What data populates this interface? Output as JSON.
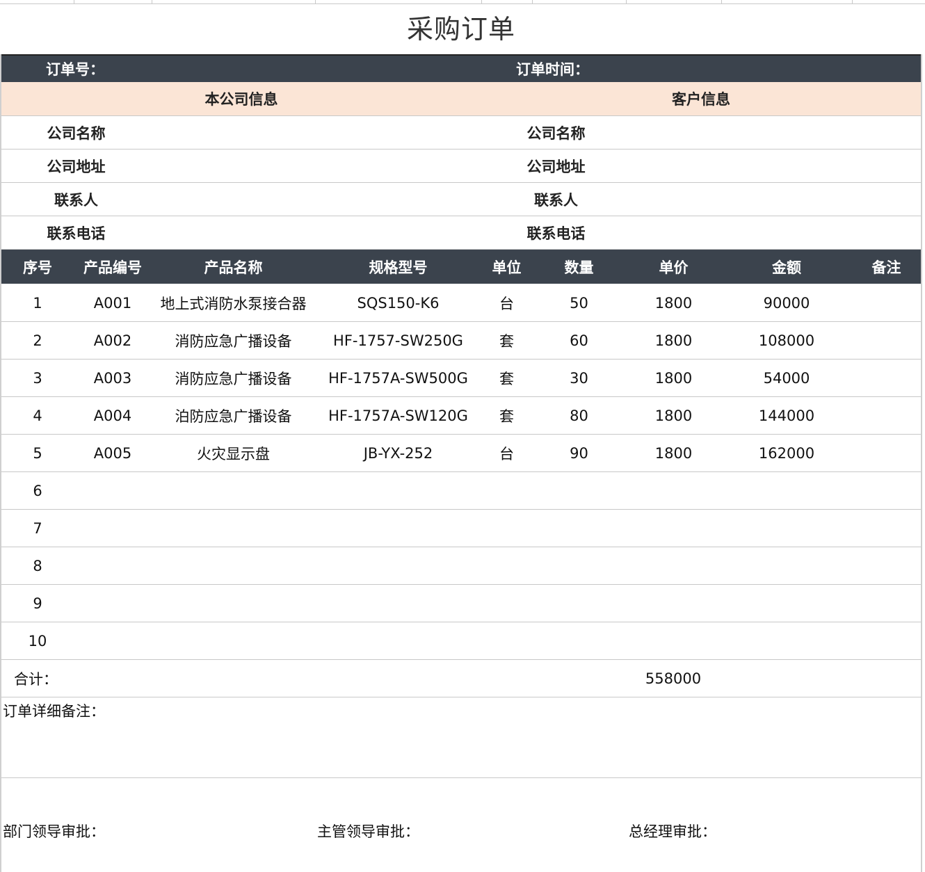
{
  "title": "采购订单",
  "order_bar": {
    "order_no_label": "订单号：",
    "order_time_label": "订单时间："
  },
  "info_header": {
    "own_company": "本公司信息",
    "customer": "客户信息"
  },
  "info_rows": [
    {
      "left": "公司名称",
      "right": "公司名称"
    },
    {
      "left": "公司地址",
      "right": "公司地址"
    },
    {
      "left": "联系人",
      "right": "联系人"
    },
    {
      "left": "联系电话",
      "right": "联系电话"
    }
  ],
  "table_headers": [
    "序号",
    "产品编号",
    "产品名称",
    "规格型号",
    "单位",
    "数量",
    "单价",
    "金额",
    "备注"
  ],
  "rows": [
    [
      "1",
      "A001",
      "地上式消防水泵接合器",
      "SQS150-K6",
      "台",
      "50",
      "1800",
      "90000",
      ""
    ],
    [
      "2",
      "A002",
      "消防应急广播设备",
      "HF-1757-SW250G",
      "套",
      "60",
      "1800",
      "108000",
      ""
    ],
    [
      "3",
      "A003",
      "消防应急广播设备",
      "HF-1757A-SW500G",
      "套",
      "30",
      "1800",
      "54000",
      ""
    ],
    [
      "4",
      "A004",
      "泊防应急广播设备",
      "HF-1757A-SW120G",
      "套",
      "80",
      "1800",
      "144000",
      ""
    ],
    [
      "5",
      "A005",
      "火灾显示盘",
      "JB-YX-252",
      "台",
      "90",
      "1800",
      "162000",
      ""
    ],
    [
      "6",
      "",
      "",
      "",
      "",
      "",
      "",
      "",
      ""
    ],
    [
      "7",
      "",
      "",
      "",
      "",
      "",
      "",
      "",
      ""
    ],
    [
      "8",
      "",
      "",
      "",
      "",
      "",
      "",
      "",
      ""
    ],
    [
      "9",
      "",
      "",
      "",
      "",
      "",
      "",
      "",
      ""
    ],
    [
      "10",
      "",
      "",
      "",
      "",
      "",
      "",
      "",
      ""
    ]
  ],
  "total": {
    "label": "合计：",
    "value": "558000"
  },
  "remarks_label": "订单详细备注：",
  "approvals": {
    "dept": "部门领导审批：",
    "supervisor": "主管领导审批：",
    "gm": "总经理审批："
  }
}
